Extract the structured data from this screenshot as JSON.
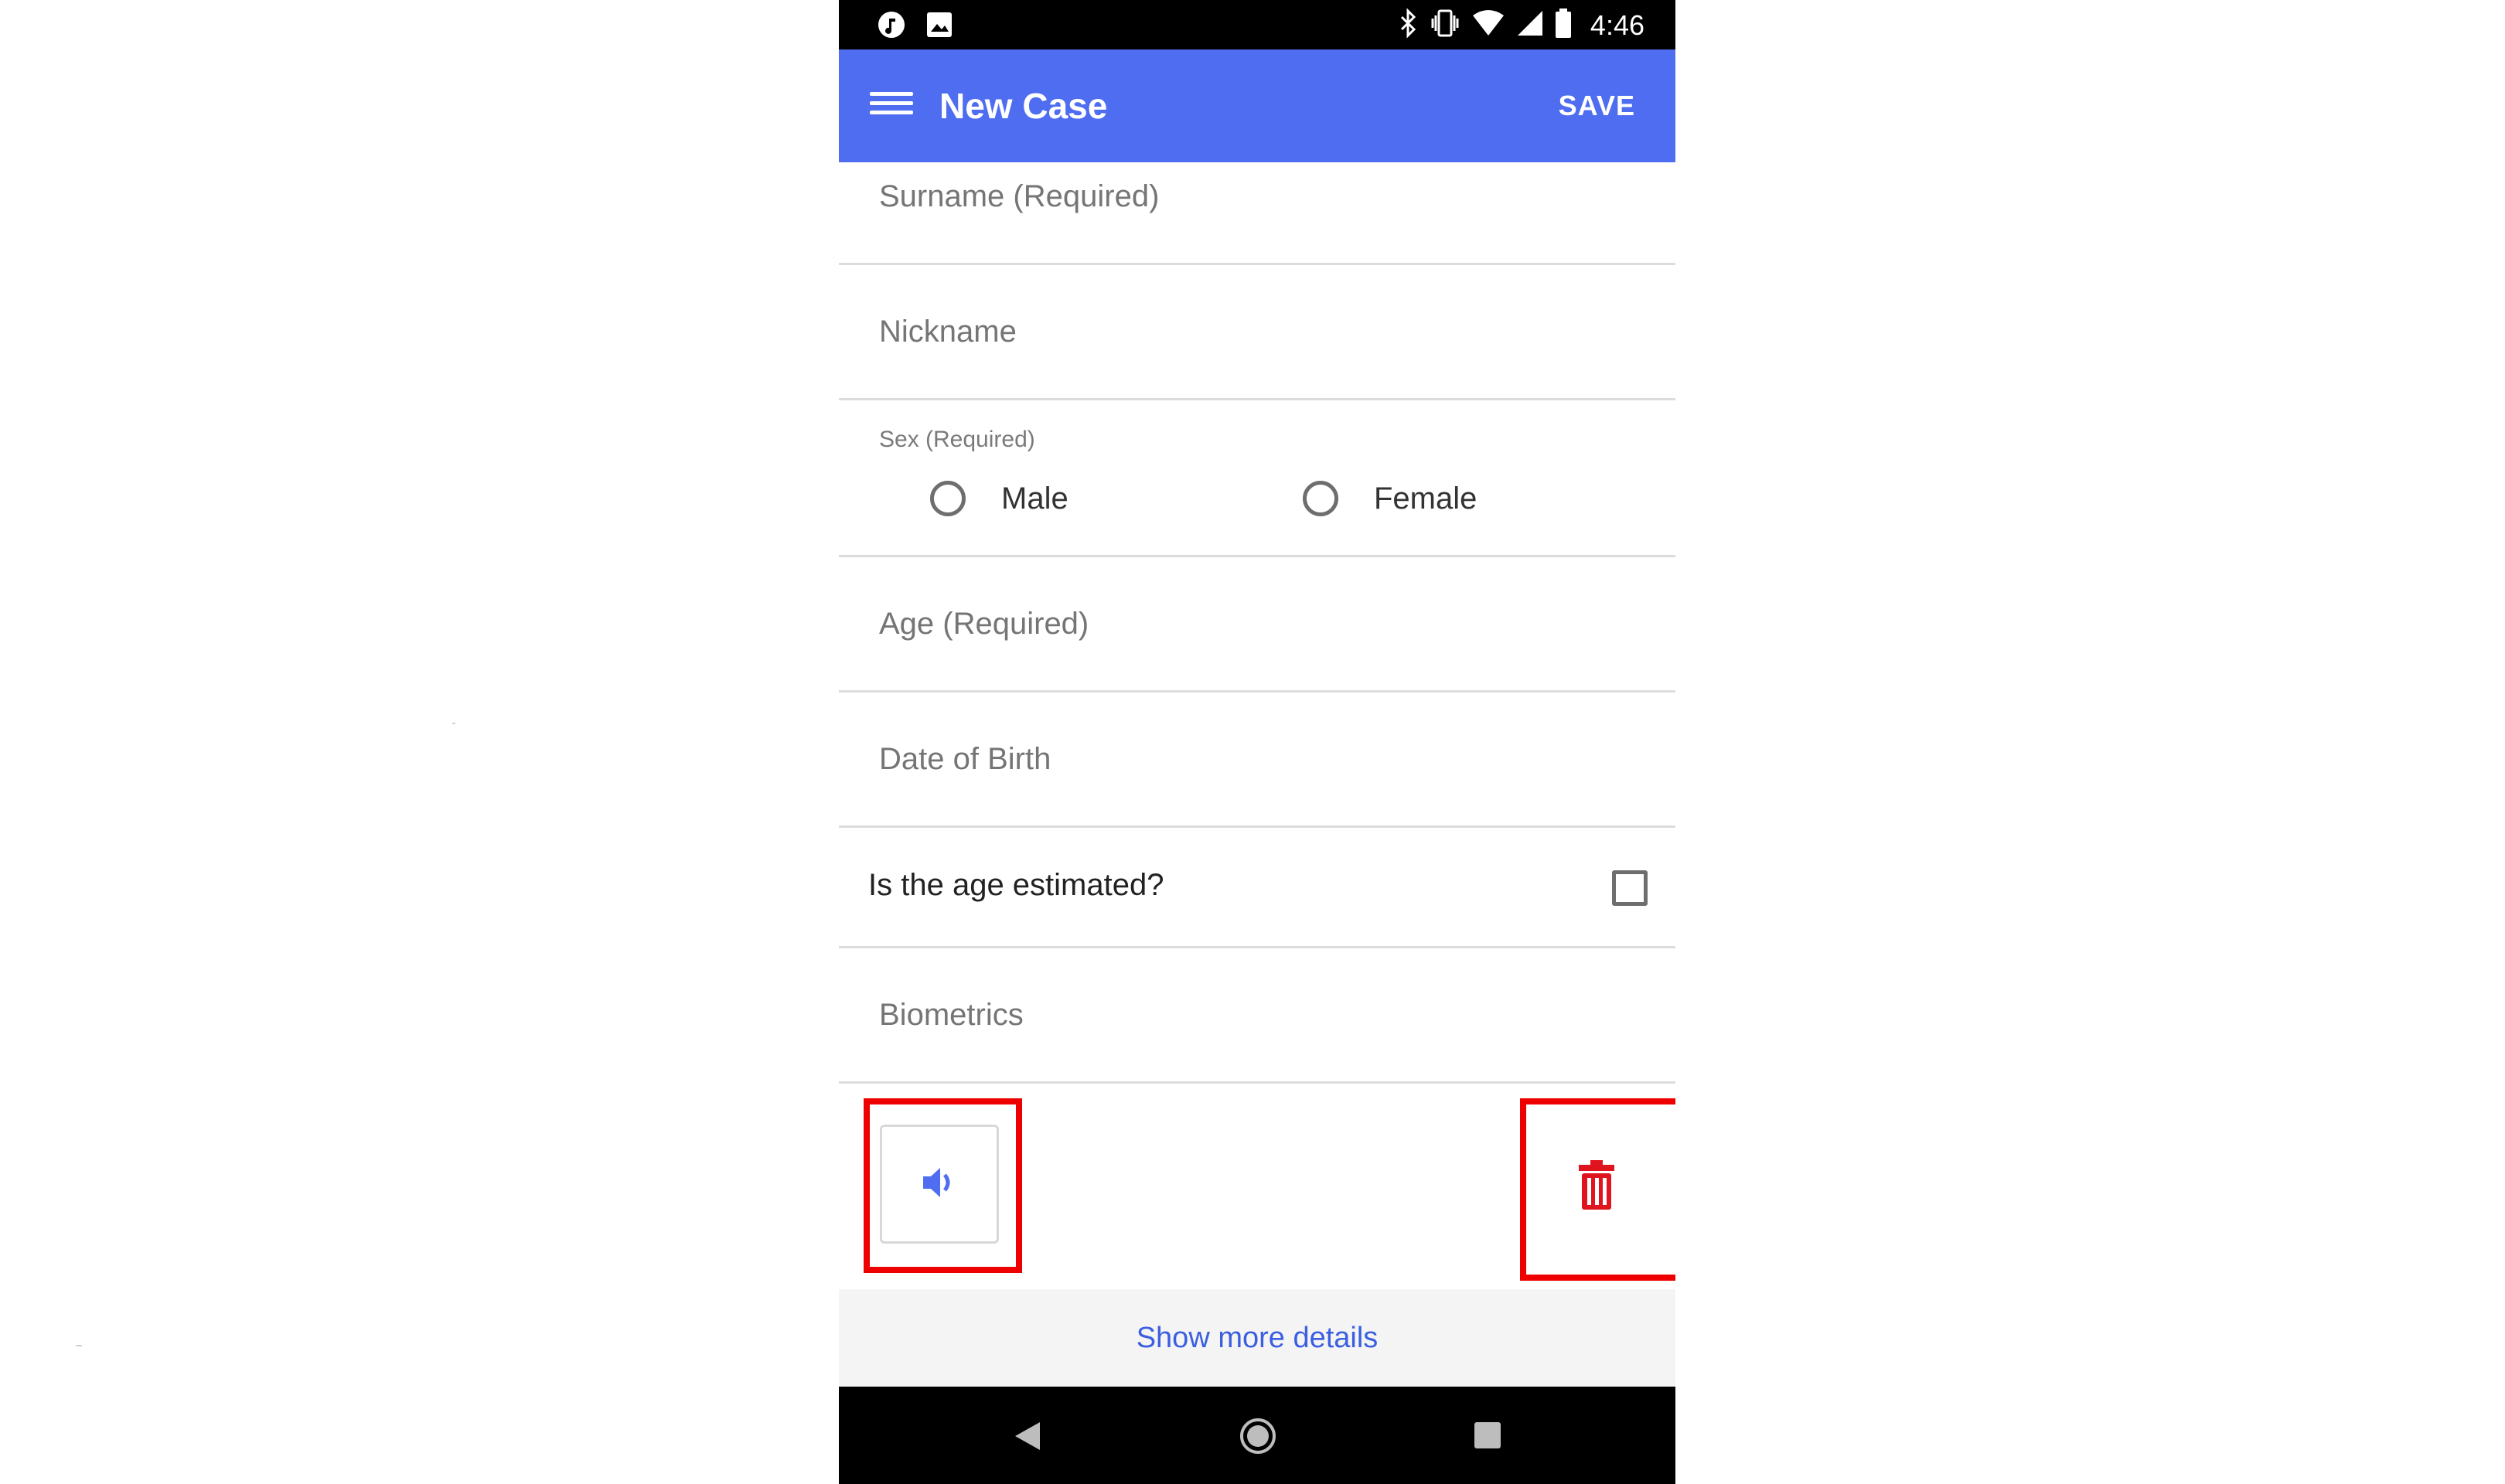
{
  "status_bar": {
    "time": "4:46",
    "left_icons": [
      "music-icon",
      "image-icon"
    ],
    "right_icons": [
      "bluetooth-icon",
      "vibrate-icon",
      "wifi-icon",
      "signal-icon",
      "battery-icon"
    ]
  },
  "app_bar": {
    "title": "New Case",
    "save_label": "SAVE",
    "background": "#4f6df0"
  },
  "form": {
    "surname_placeholder": "Surname (Required)",
    "nickname_placeholder": "Nickname",
    "sex_label": "Sex (Required)",
    "sex_options": [
      "Male",
      "Female"
    ],
    "age_placeholder": "Age (Required)",
    "dob_placeholder": "Date of Birth",
    "age_estimated_label": "Is the age estimated?",
    "biometrics_placeholder": "Biometrics"
  },
  "controls": {
    "sound_icon": "volume-icon",
    "delete_icon": "trash-icon",
    "delete_color": "#e0141e",
    "highlight_color": "#ee0000"
  },
  "more_details_label": "Show more details",
  "nav_bar": {
    "icons": [
      "back-icon",
      "home-icon",
      "recent-apps-icon"
    ]
  }
}
